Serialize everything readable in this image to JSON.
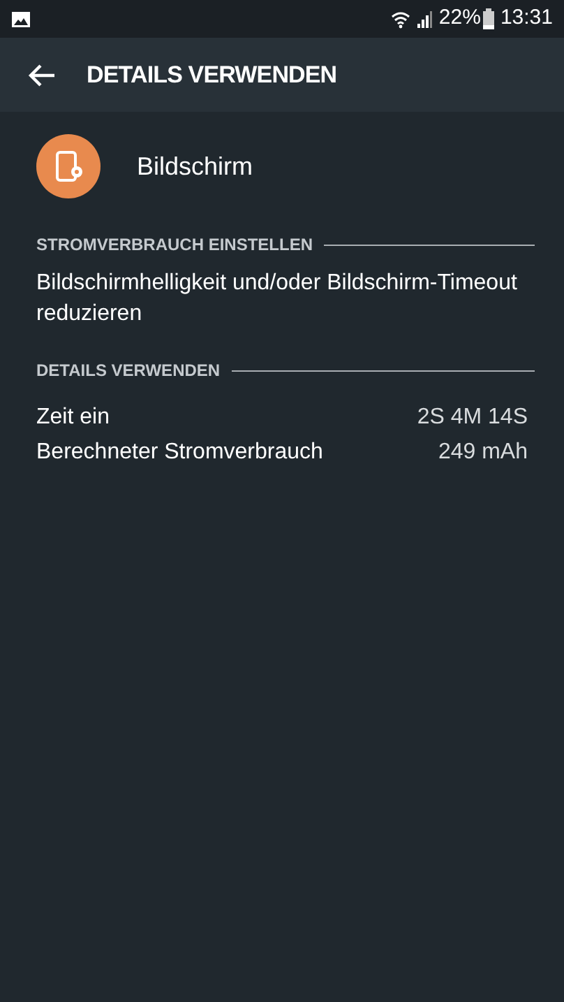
{
  "status_bar": {
    "battery_percent": "22%",
    "time": "13:31"
  },
  "app_bar": {
    "title": "DETAILS VERWENDEN"
  },
  "app": {
    "name": "Bildschirm"
  },
  "sections": [
    {
      "header": "STROMVERBRAUCH EINSTELLEN",
      "kind": "text",
      "text": "Bildschirmhelligkeit und/oder Bildschirm-Timeout reduzieren"
    },
    {
      "header": "DETAILS VERWENDEN",
      "kind": "rows",
      "rows": [
        {
          "label": "Zeit ein",
          "value": "2S 4M 14S"
        },
        {
          "label": "Berechneter Stromverbrauch",
          "value": "249 mAh"
        }
      ]
    }
  ]
}
